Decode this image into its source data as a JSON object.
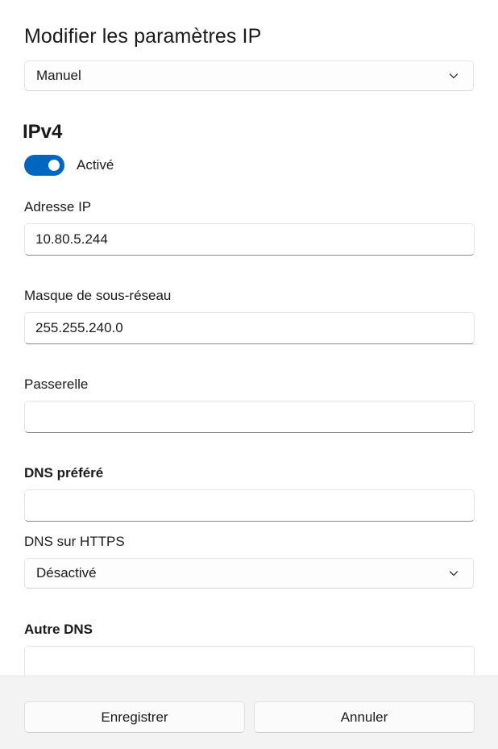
{
  "dialog": {
    "title": "Modifier les paramètres IP",
    "mode_select": {
      "value": "Manuel",
      "icon": "chevron-down-icon"
    }
  },
  "ipv4": {
    "section_title": "IPv4",
    "toggle": {
      "state": "on",
      "label": "Activé",
      "accent_color": "#0067c0"
    },
    "ip_address": {
      "label": "Adresse IP",
      "value": "10.80.5.244"
    },
    "subnet_mask": {
      "label": "Masque de sous-réseau",
      "value": "255.255.240.0"
    },
    "gateway": {
      "label": "Passerelle",
      "value": ""
    },
    "preferred_dns": {
      "label": "DNS préféré",
      "value": ""
    },
    "dns_over_https": {
      "label": "DNS sur HTTPS",
      "value": "Désactivé",
      "icon": "chevron-down-icon"
    },
    "alternate_dns": {
      "label": "Autre DNS",
      "value": ""
    }
  },
  "footer": {
    "save_label": "Enregistrer",
    "cancel_label": "Annuler"
  }
}
